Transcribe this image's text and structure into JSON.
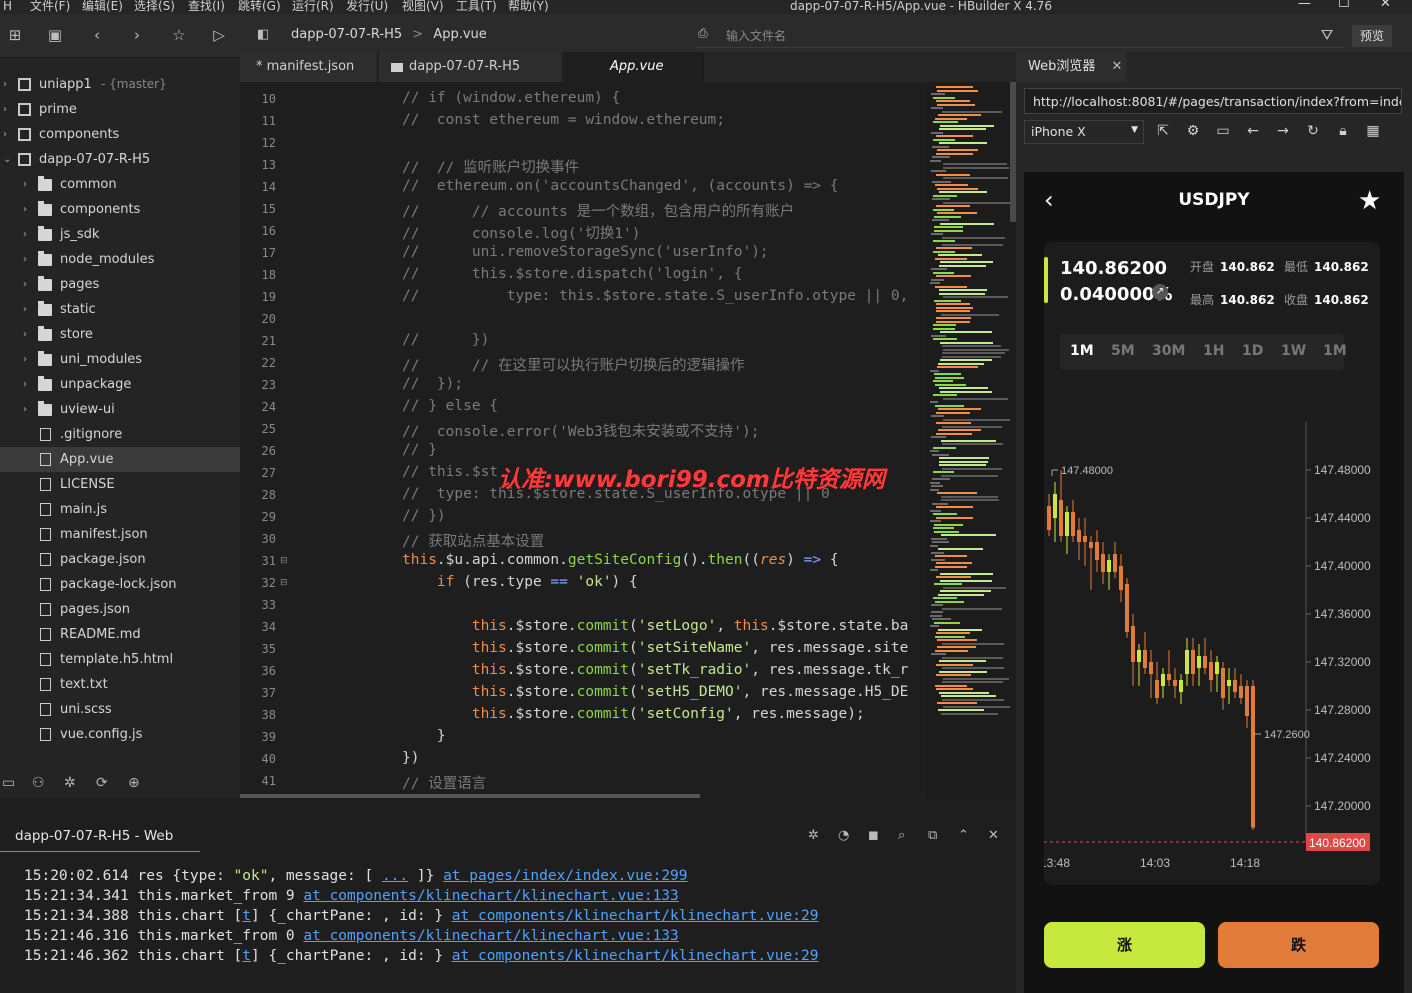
{
  "menu": [
    "文件(F)",
    "编辑(E)",
    "选择(S)",
    "查找(I)",
    "跳转(G)",
    "运行(R)",
    "发行(U)",
    "视图(V)",
    "工具(T)",
    "帮助(Y)"
  ],
  "window_title": "dapp-07-07-R-H5/App.vue - HBuilder X 4.76",
  "toolbar": {
    "crumb_project": "dapp-07-07-R-H5",
    "crumb_sep": ">",
    "crumb_file": "App.vue",
    "file_input_placeholder": "输入文件名",
    "preview_label": "预览"
  },
  "sidebar": {
    "projects": [
      {
        "name": "uniapp1",
        "branch": "- {master}"
      },
      {
        "name": "prime"
      },
      {
        "name": "components"
      },
      {
        "name": "dapp-07-07-R-H5"
      }
    ],
    "folders": [
      "common",
      "components",
      "js_sdk",
      "node_modules",
      "pages",
      "static",
      "store",
      "uni_modules",
      "unpackage",
      "uview-ui"
    ],
    "files": [
      ".gitignore",
      "App.vue",
      "LICENSE",
      "main.js",
      "manifest.json",
      "package.json",
      "package-lock.json",
      "pages.json",
      "README.md",
      "template.h5.html",
      "text.txt",
      "uni.scss",
      "vue.config.js"
    ]
  },
  "tabs": [
    "* manifest.json",
    "dapp-07-07-R-H5",
    "App.vue"
  ],
  "editor": {
    "line_numbers": [
      10,
      11,
      12,
      13,
      14,
      15,
      16,
      17,
      18,
      19,
      20,
      21,
      22,
      23,
      24,
      25,
      26,
      27,
      28,
      29,
      30,
      31,
      32,
      33,
      34,
      35,
      36,
      37,
      38,
      39,
      40,
      41
    ],
    "watermark": "认准:www.bori99.com比特资源网"
  },
  "browser": {
    "tab_label": "Web浏览器",
    "url": "http://localhost:8081/#/pages/transaction/index?from=index&",
    "device": "iPhone X",
    "title": "USDJPY",
    "price": "140.86200",
    "change_pct": "0.040000%",
    "stats": [
      {
        "label": "开盘",
        "value": "140.862"
      },
      {
        "label": "最低",
        "value": "140.862"
      },
      {
        "label": "最高",
        "value": "140.862"
      },
      {
        "label": "收盘",
        "value": "140.862"
      }
    ],
    "timeframes": [
      "1M",
      "5M",
      "30M",
      "1H",
      "1D",
      "1W",
      "1M"
    ],
    "active_timeframe": 0,
    "buy_label": "涨",
    "sell_label": "跌",
    "colors": {
      "up": "#c7e83c",
      "down": "#e07b39",
      "last_price_line": "#e04848"
    }
  },
  "chart_data": {
    "type": "candlestick",
    "y_ticks": [
      "147.48000",
      "147.44000",
      "147.40000",
      "147.36000",
      "147.32000",
      "147.28000",
      "147.24000",
      "147.20000"
    ],
    "ylim": [
      147.17,
      147.52
    ],
    "x_ticks": [
      "13:48",
      "14:03",
      "14:18"
    ],
    "high_label": "147.48000",
    "low_label": "147.2600",
    "last_price_label": "140.86200",
    "candles": [
      {
        "o": 147.45,
        "h": 147.46,
        "l": 147.425,
        "c": 147.43
      },
      {
        "o": 147.44,
        "h": 147.47,
        "l": 147.42,
        "c": 147.46
      },
      {
        "o": 147.455,
        "h": 147.48,
        "l": 147.42,
        "c": 147.425
      },
      {
        "o": 147.425,
        "h": 147.45,
        "l": 147.41,
        "c": 147.445
      },
      {
        "o": 147.445,
        "h": 147.455,
        "l": 147.42,
        "c": 147.425
      },
      {
        "o": 147.43,
        "h": 147.44,
        "l": 147.405,
        "c": 147.42
      },
      {
        "o": 147.425,
        "h": 147.44,
        "l": 147.4,
        "c": 147.42
      },
      {
        "o": 147.42,
        "h": 147.425,
        "l": 147.38,
        "c": 147.415
      },
      {
        "o": 147.42,
        "h": 147.43,
        "l": 147.395,
        "c": 147.405
      },
      {
        "o": 147.41,
        "h": 147.42,
        "l": 147.385,
        "c": 147.395
      },
      {
        "o": 147.395,
        "h": 147.41,
        "l": 147.38,
        "c": 147.405
      },
      {
        "o": 147.41,
        "h": 147.42,
        "l": 147.39,
        "c": 147.395
      },
      {
        "o": 147.4,
        "h": 147.41,
        "l": 147.37,
        "c": 147.38
      },
      {
        "o": 147.385,
        "h": 147.39,
        "l": 147.34,
        "c": 147.345
      },
      {
        "o": 147.35,
        "h": 147.36,
        "l": 147.3,
        "c": 147.32
      },
      {
        "o": 147.32,
        "h": 147.335,
        "l": 147.3,
        "c": 147.33
      },
      {
        "o": 147.33,
        "h": 147.345,
        "l": 147.31,
        "c": 147.315
      },
      {
        "o": 147.32,
        "h": 147.33,
        "l": 147.29,
        "c": 147.31
      },
      {
        "o": 147.305,
        "h": 147.32,
        "l": 147.285,
        "c": 147.29
      },
      {
        "o": 147.3,
        "h": 147.315,
        "l": 147.29,
        "c": 147.31
      },
      {
        "o": 147.31,
        "h": 147.33,
        "l": 147.3,
        "c": 147.305
      },
      {
        "o": 147.305,
        "h": 147.315,
        "l": 147.29,
        "c": 147.3
      },
      {
        "o": 147.295,
        "h": 147.31,
        "l": 147.285,
        "c": 147.305
      },
      {
        "o": 147.31,
        "h": 147.34,
        "l": 147.3,
        "c": 147.33
      },
      {
        "o": 147.33,
        "h": 147.34,
        "l": 147.3,
        "c": 147.31
      },
      {
        "o": 147.315,
        "h": 147.335,
        "l": 147.3,
        "c": 147.325
      },
      {
        "o": 147.325,
        "h": 147.34,
        "l": 147.31,
        "c": 147.315
      },
      {
        "o": 147.32,
        "h": 147.33,
        "l": 147.295,
        "c": 147.305
      },
      {
        "o": 147.31,
        "h": 147.325,
        "l": 147.295,
        "c": 147.32
      },
      {
        "o": 147.315,
        "h": 147.32,
        "l": 147.28,
        "c": 147.29
      },
      {
        "o": 147.3,
        "h": 147.315,
        "l": 147.285,
        "c": 147.305
      },
      {
        "o": 147.305,
        "h": 147.315,
        "l": 147.29,
        "c": 147.295
      },
      {
        "o": 147.3,
        "h": 147.31,
        "l": 147.285,
        "c": 147.29
      },
      {
        "o": 147.3,
        "h": 147.305,
        "l": 147.265,
        "c": 147.275
      },
      {
        "o": 147.3,
        "h": 147.305,
        "l": 147.18,
        "c": 147.182
      }
    ]
  },
  "console": {
    "title": "dapp-07-07-R-H5 - Web",
    "lines": [
      {
        "time": "15:20:02.614",
        "pre": "res {type: ",
        "str": "\"ok\"",
        "mid": ", message: [ ",
        "link1": "...",
        "post": " ]} ",
        "link": "at pages/index/index.vue:299"
      },
      {
        "time": "15:21:34.341",
        "pre": "this.market_from 9 ",
        "str": "",
        "mid": "",
        "link1": "",
        "post": "",
        "link": "at components/klinechart/klinechart.vue:133"
      },
      {
        "time": "15:21:34.388",
        "pre": "this.chart [",
        "str": "",
        "mid": "",
        "link1": "t",
        "post": "] {_chartPane: , id: } ",
        "link": "at components/klinechart/klinechart.vue:29"
      },
      {
        "time": "15:21:46.316",
        "pre": "this.market_from 0 ",
        "str": "",
        "mid": "",
        "link1": "",
        "post": "",
        "link": "at components/klinechart/klinechart.vue:133"
      },
      {
        "time": "15:21:46.362",
        "pre": "this.chart [",
        "str": "",
        "mid": "",
        "link1": "t",
        "post": "] {_chartPane: , id: } ",
        "link": "at components/klinechart/klinechart.vue:29"
      }
    ]
  }
}
